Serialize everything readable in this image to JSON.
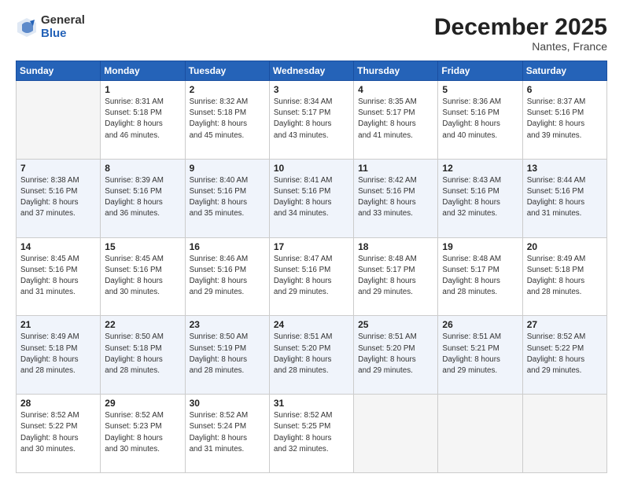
{
  "logo": {
    "general": "General",
    "blue": "Blue"
  },
  "header": {
    "month": "December 2025",
    "location": "Nantes, France"
  },
  "weekdays": [
    "Sunday",
    "Monday",
    "Tuesday",
    "Wednesday",
    "Thursday",
    "Friday",
    "Saturday"
  ],
  "weeks": [
    [
      {
        "day": "",
        "info": ""
      },
      {
        "day": "1",
        "info": "Sunrise: 8:31 AM\nSunset: 5:18 PM\nDaylight: 8 hours\nand 46 minutes."
      },
      {
        "day": "2",
        "info": "Sunrise: 8:32 AM\nSunset: 5:18 PM\nDaylight: 8 hours\nand 45 minutes."
      },
      {
        "day": "3",
        "info": "Sunrise: 8:34 AM\nSunset: 5:17 PM\nDaylight: 8 hours\nand 43 minutes."
      },
      {
        "day": "4",
        "info": "Sunrise: 8:35 AM\nSunset: 5:17 PM\nDaylight: 8 hours\nand 41 minutes."
      },
      {
        "day": "5",
        "info": "Sunrise: 8:36 AM\nSunset: 5:16 PM\nDaylight: 8 hours\nand 40 minutes."
      },
      {
        "day": "6",
        "info": "Sunrise: 8:37 AM\nSunset: 5:16 PM\nDaylight: 8 hours\nand 39 minutes."
      }
    ],
    [
      {
        "day": "7",
        "info": "Sunrise: 8:38 AM\nSunset: 5:16 PM\nDaylight: 8 hours\nand 37 minutes."
      },
      {
        "day": "8",
        "info": "Sunrise: 8:39 AM\nSunset: 5:16 PM\nDaylight: 8 hours\nand 36 minutes."
      },
      {
        "day": "9",
        "info": "Sunrise: 8:40 AM\nSunset: 5:16 PM\nDaylight: 8 hours\nand 35 minutes."
      },
      {
        "day": "10",
        "info": "Sunrise: 8:41 AM\nSunset: 5:16 PM\nDaylight: 8 hours\nand 34 minutes."
      },
      {
        "day": "11",
        "info": "Sunrise: 8:42 AM\nSunset: 5:16 PM\nDaylight: 8 hours\nand 33 minutes."
      },
      {
        "day": "12",
        "info": "Sunrise: 8:43 AM\nSunset: 5:16 PM\nDaylight: 8 hours\nand 32 minutes."
      },
      {
        "day": "13",
        "info": "Sunrise: 8:44 AM\nSunset: 5:16 PM\nDaylight: 8 hours\nand 31 minutes."
      }
    ],
    [
      {
        "day": "14",
        "info": "Sunrise: 8:45 AM\nSunset: 5:16 PM\nDaylight: 8 hours\nand 31 minutes."
      },
      {
        "day": "15",
        "info": "Sunrise: 8:45 AM\nSunset: 5:16 PM\nDaylight: 8 hours\nand 30 minutes."
      },
      {
        "day": "16",
        "info": "Sunrise: 8:46 AM\nSunset: 5:16 PM\nDaylight: 8 hours\nand 29 minutes."
      },
      {
        "day": "17",
        "info": "Sunrise: 8:47 AM\nSunset: 5:16 PM\nDaylight: 8 hours\nand 29 minutes."
      },
      {
        "day": "18",
        "info": "Sunrise: 8:48 AM\nSunset: 5:17 PM\nDaylight: 8 hours\nand 29 minutes."
      },
      {
        "day": "19",
        "info": "Sunrise: 8:48 AM\nSunset: 5:17 PM\nDaylight: 8 hours\nand 28 minutes."
      },
      {
        "day": "20",
        "info": "Sunrise: 8:49 AM\nSunset: 5:18 PM\nDaylight: 8 hours\nand 28 minutes."
      }
    ],
    [
      {
        "day": "21",
        "info": "Sunrise: 8:49 AM\nSunset: 5:18 PM\nDaylight: 8 hours\nand 28 minutes."
      },
      {
        "day": "22",
        "info": "Sunrise: 8:50 AM\nSunset: 5:18 PM\nDaylight: 8 hours\nand 28 minutes."
      },
      {
        "day": "23",
        "info": "Sunrise: 8:50 AM\nSunset: 5:19 PM\nDaylight: 8 hours\nand 28 minutes."
      },
      {
        "day": "24",
        "info": "Sunrise: 8:51 AM\nSunset: 5:20 PM\nDaylight: 8 hours\nand 28 minutes."
      },
      {
        "day": "25",
        "info": "Sunrise: 8:51 AM\nSunset: 5:20 PM\nDaylight: 8 hours\nand 29 minutes."
      },
      {
        "day": "26",
        "info": "Sunrise: 8:51 AM\nSunset: 5:21 PM\nDaylight: 8 hours\nand 29 minutes."
      },
      {
        "day": "27",
        "info": "Sunrise: 8:52 AM\nSunset: 5:22 PM\nDaylight: 8 hours\nand 29 minutes."
      }
    ],
    [
      {
        "day": "28",
        "info": "Sunrise: 8:52 AM\nSunset: 5:22 PM\nDaylight: 8 hours\nand 30 minutes."
      },
      {
        "day": "29",
        "info": "Sunrise: 8:52 AM\nSunset: 5:23 PM\nDaylight: 8 hours\nand 30 minutes."
      },
      {
        "day": "30",
        "info": "Sunrise: 8:52 AM\nSunset: 5:24 PM\nDaylight: 8 hours\nand 31 minutes."
      },
      {
        "day": "31",
        "info": "Sunrise: 8:52 AM\nSunset: 5:25 PM\nDaylight: 8 hours\nand 32 minutes."
      },
      {
        "day": "",
        "info": ""
      },
      {
        "day": "",
        "info": ""
      },
      {
        "day": "",
        "info": ""
      }
    ]
  ]
}
